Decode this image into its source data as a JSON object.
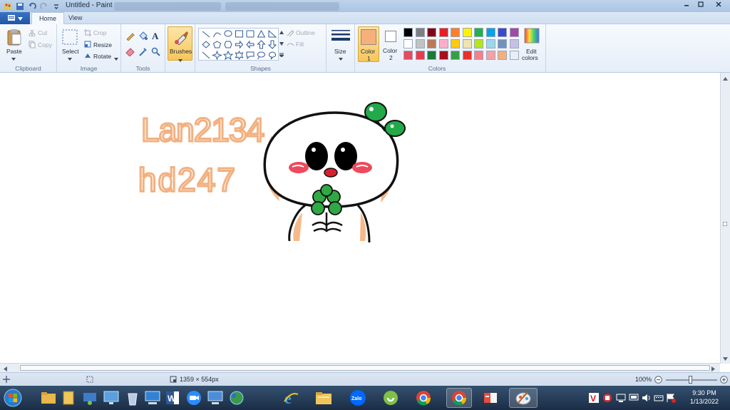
{
  "window": {
    "title": "Untitled - Paint"
  },
  "tabs": {
    "home": "Home",
    "view": "View"
  },
  "clipboard": {
    "paste": "Paste",
    "cut": "Cut",
    "copy": "Copy",
    "label": "Clipboard"
  },
  "image": {
    "select": "Select",
    "crop": "Crop",
    "resize": "Resize",
    "rotate": "Rotate",
    "label": "Image"
  },
  "tools": {
    "label": "Tools"
  },
  "brushes": {
    "label": "Brushes"
  },
  "shapes": {
    "outline": "Outline",
    "fill": "Fill",
    "label": "Shapes"
  },
  "size": {
    "label": "Size"
  },
  "colors": {
    "color1_label": "Color",
    "color1_num": "1",
    "color1_value": "#f8b07a",
    "color2_label": "Color",
    "color2_num": "2",
    "color2_value": "#ffffff",
    "edit": "Edit",
    "edit2": "colors",
    "label": "Colors",
    "palette": [
      [
        "#000000",
        "#7f7f7f",
        "#880015",
        "#ed1c24",
        "#ff7f27",
        "#fff200",
        "#22b14c",
        "#00a2e8",
        "#3f48cc",
        "#a349a4"
      ],
      [
        "#ffffff",
        "#c3c3c3",
        "#b97a57",
        "#ffaec9",
        "#ffc90e",
        "#efe4b0",
        "#b5e61d",
        "#99d9ea",
        "#7092be",
        "#c8bfe7"
      ],
      [
        "#e84a5f",
        "#e83c4b",
        "#1a7a3c",
        "#a50f1e",
        "#34a045",
        "#e8312d",
        "#f3808a",
        "#f2a2a8",
        "#f3b07f",
        "#e9eef4",
        "#e9eef4"
      ]
    ]
  },
  "canvas_text": {
    "line1": "Lan2134",
    "line2": "hd247"
  },
  "status": {
    "dimensions": "1359 × 554px",
    "zoom": "100%"
  },
  "taskbar": {
    "zalo": "Zalo",
    "time": "9:30 PM",
    "date": "1/13/2022"
  }
}
